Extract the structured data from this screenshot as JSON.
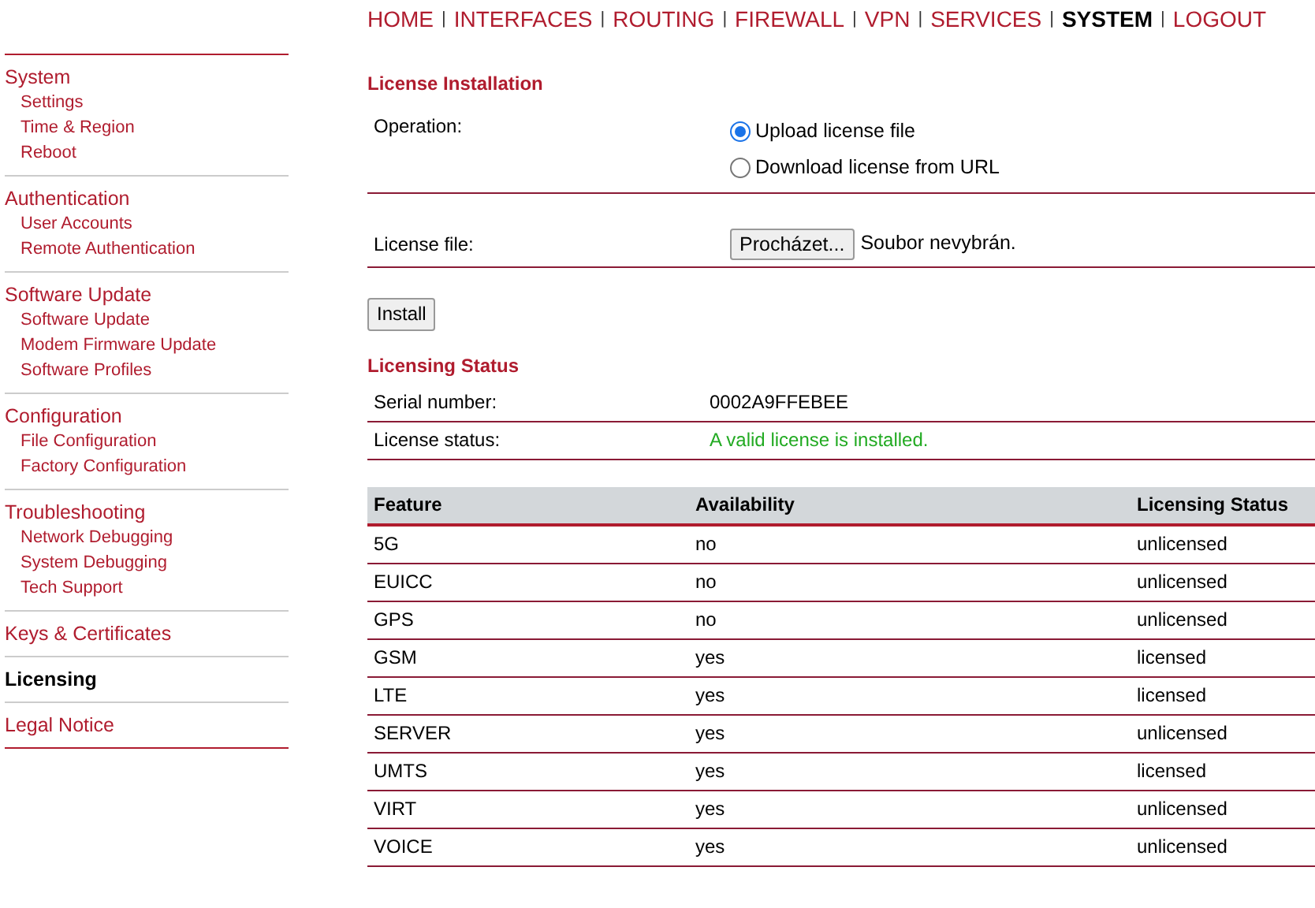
{
  "top_nav": [
    {
      "label": "HOME",
      "selected": false
    },
    {
      "label": "INTERFACES",
      "selected": false
    },
    {
      "label": "ROUTING",
      "selected": false
    },
    {
      "label": "FIREWALL",
      "selected": false
    },
    {
      "label": "VPN",
      "selected": false
    },
    {
      "label": "SERVICES",
      "selected": false
    },
    {
      "label": "SYSTEM",
      "selected": true
    },
    {
      "label": "LOGOUT",
      "selected": false
    }
  ],
  "nav_separator": "|",
  "sidebar": {
    "groups": [
      {
        "title": "System",
        "selected": false,
        "children": [
          {
            "label": "Settings"
          },
          {
            "label": "Time & Region"
          },
          {
            "label": "Reboot"
          }
        ]
      },
      {
        "title": "Authentication",
        "selected": false,
        "children": [
          {
            "label": "User Accounts"
          },
          {
            "label": "Remote Authentication"
          }
        ]
      },
      {
        "title": "Software Update",
        "selected": false,
        "children": [
          {
            "label": "Software Update"
          },
          {
            "label": "Modem Firmware Update"
          },
          {
            "label": "Software Profiles"
          }
        ]
      },
      {
        "title": "Configuration",
        "selected": false,
        "children": [
          {
            "label": "File Configuration"
          },
          {
            "label": "Factory Configuration"
          }
        ]
      },
      {
        "title": "Troubleshooting",
        "selected": false,
        "children": [
          {
            "label": "Network Debugging"
          },
          {
            "label": "System Debugging"
          },
          {
            "label": "Tech Support"
          }
        ]
      },
      {
        "title": "Keys & Certificates",
        "selected": false
      },
      {
        "title": "Licensing",
        "selected": true
      },
      {
        "title": "Legal Notice",
        "selected": false
      }
    ]
  },
  "license_installation": {
    "title": "License Installation",
    "operation_label": "Operation:",
    "options": [
      {
        "label": "Upload license file",
        "selected": true
      },
      {
        "label": "Download license from URL",
        "selected": false
      }
    ],
    "file_label": "License file:",
    "browse_button": "Procházet...",
    "file_status": "Soubor nevybrán.",
    "install_button": "Install"
  },
  "licensing_status": {
    "title": "Licensing Status",
    "rows": [
      {
        "label": "Serial number:",
        "value": "0002A9FFEBEE",
        "ok": false
      },
      {
        "label": "License status:",
        "value": "A valid license is installed.",
        "ok": true
      }
    ]
  },
  "table": {
    "columns": [
      "Feature",
      "Availability",
      "Licensing Status"
    ],
    "rows": [
      [
        "5G",
        "no",
        "unlicensed"
      ],
      [
        "EUICC",
        "no",
        "unlicensed"
      ],
      [
        "GPS",
        "no",
        "unlicensed"
      ],
      [
        "GSM",
        "yes",
        "licensed"
      ],
      [
        "LTE",
        "yes",
        "licensed"
      ],
      [
        "SERVER",
        "yes",
        "unlicensed"
      ],
      [
        "UMTS",
        "yes",
        "licensed"
      ],
      [
        "VIRT",
        "yes",
        "unlicensed"
      ],
      [
        "VOICE",
        "yes",
        "unlicensed"
      ]
    ]
  }
}
